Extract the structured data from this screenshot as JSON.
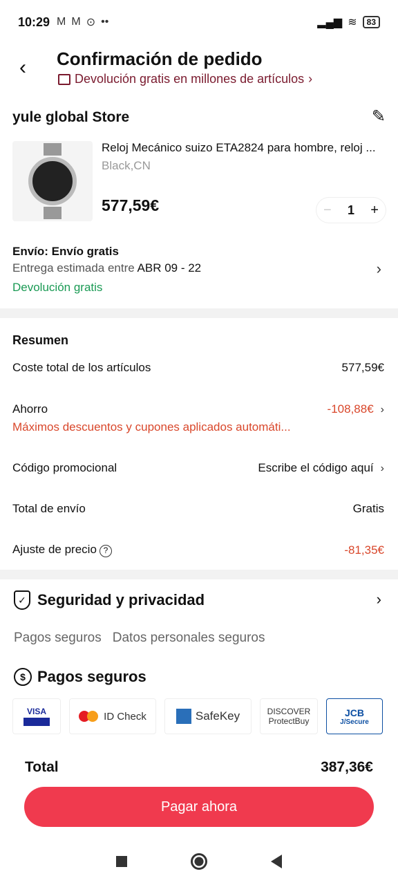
{
  "status_bar": {
    "time": "10:29",
    "icons": [
      "gmail-icon",
      "gmail-icon",
      "location-icon"
    ],
    "battery": "83"
  },
  "header": {
    "title": "Confirmación de pedido",
    "subtitle": "Devolución gratis en millones de artículos"
  },
  "store": {
    "name": "yule global Store",
    "product_title": "Reloj Mecánico suizo ETA2824 para hombre, reloj ...",
    "variant": "Black,CN",
    "price": "577,59€",
    "quantity": "1"
  },
  "shipping": {
    "title": "Envío: Envío gratis",
    "estimate_prefix": "Entrega estimada entre",
    "estimate_dates": "ABR 09 - 22",
    "free_return": "Devolución gratis"
  },
  "summary": {
    "heading": "Resumen",
    "items_label": "Coste total de los artículos",
    "items_value": "577,59€",
    "savings_label": "Ahorro",
    "savings_sub": "Máximos descuentos y cupones aplicados automáti...",
    "savings_value": "-108,88€",
    "promo_label": "Código promocional",
    "promo_value": "Escribe el código aquí",
    "shipping_label": "Total de envío",
    "shipping_value": "Gratis",
    "adjust_label": "Ajuste de precio",
    "adjust_value": "-81,35€"
  },
  "security": {
    "title": "Seguridad y privacidad",
    "sub1": "Pagos seguros",
    "sub2": "Datos personales seguros",
    "payments_title": "Pagos seguros",
    "logos": {
      "visa": "VISA",
      "visa_sub": "SECURE",
      "mc": "ID Check",
      "amex": "SafeKey",
      "discover": "DISCOVER",
      "discover_sub": "ProtectBuy",
      "jcb": "JCB",
      "jcb_sub": "J/Secure"
    }
  },
  "checkout": {
    "total_label": "Total",
    "total_value": "387,36€",
    "button": "Pagar ahora"
  },
  "colors": {
    "accent": "#f03a4e",
    "discount": "#d9472b",
    "green": "#1a9a54"
  }
}
